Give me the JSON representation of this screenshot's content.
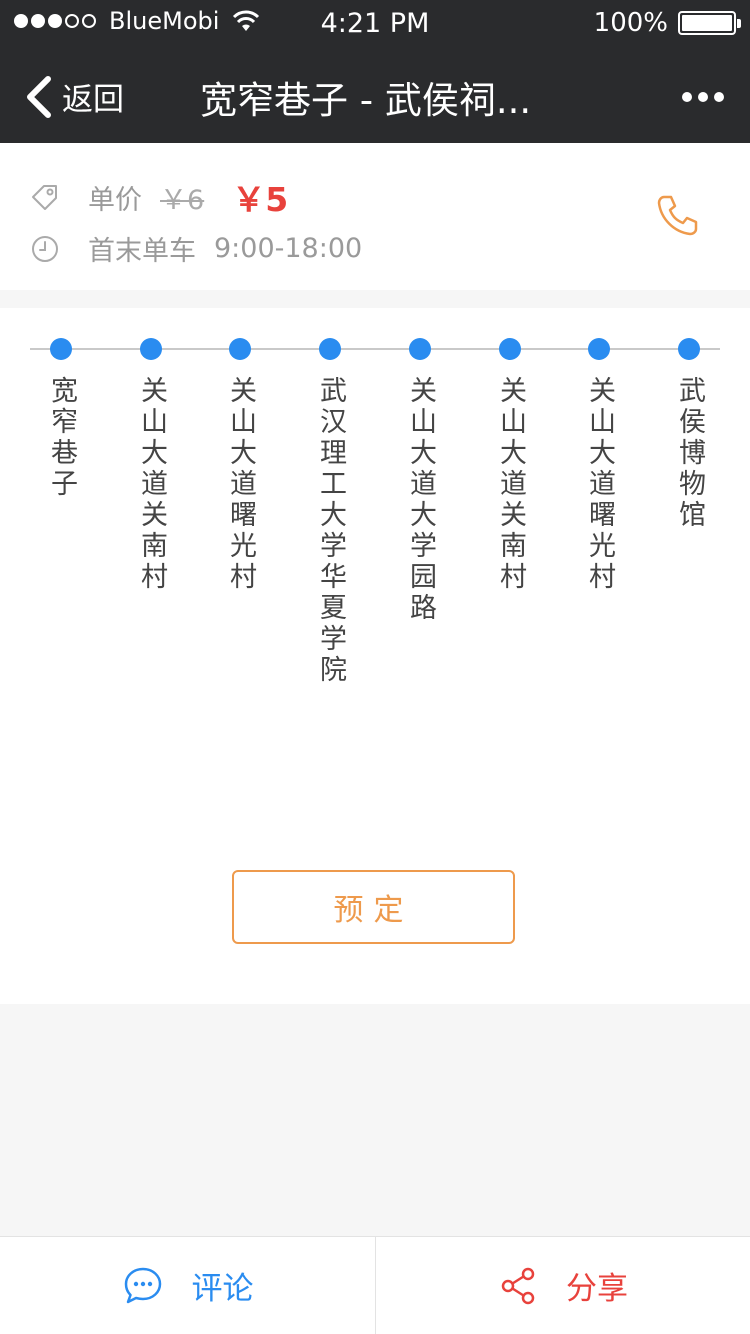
{
  "status_bar": {
    "carrier": "BlueMobi",
    "time": "4:21 PM",
    "battery": "100%"
  },
  "nav": {
    "back_label": "返回",
    "title": "宽窄巷子 - 武侯祠...",
    "more_icon": "more-icon"
  },
  "info": {
    "price_label": "单价",
    "original_price": "￥6",
    "current_price": "￥5",
    "hours_label": "首末单车",
    "hours": "9:00-18:00"
  },
  "route": {
    "stops": [
      "宽窄巷子",
      "关山大道关南村",
      "关山大道曙光村",
      "武汉理工大学华夏学院",
      "关山大道大学园路",
      "关山大道关南村",
      "关山大道曙光村",
      "武侯博物馆"
    ]
  },
  "reserve_label": "预定",
  "bottom": {
    "comment_label": "评论",
    "share_label": "分享"
  },
  "colors": {
    "nav_bg": "#2a2b2d",
    "accent_blue": "#2a8cf0",
    "accent_orange": "#ee9a4c",
    "price_red": "#e8423c"
  }
}
